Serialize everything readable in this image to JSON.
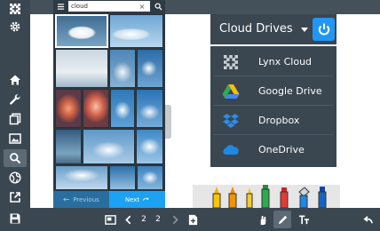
{
  "search": {
    "value": "cloud",
    "clear_glyph": "×"
  },
  "pager": {
    "prev_label": "Previous",
    "next_label": "Next"
  },
  "drives": {
    "title": "Cloud Drives",
    "items": [
      {
        "label": "Lynx Cloud",
        "icon": "lynx-cloud-icon"
      },
      {
        "label": "Google Drive",
        "icon": "google-drive-icon"
      },
      {
        "label": "Dropbox",
        "icon": "dropbox-icon"
      },
      {
        "label": "OneDrive",
        "icon": "onedrive-icon"
      }
    ]
  },
  "pagination": {
    "current": "2",
    "total": "2"
  },
  "colors": {
    "toolbar_bg": "#3a4650",
    "panel_bg": "#2e3a44",
    "accent": "#1da1f2",
    "power_button": "#2196f3"
  }
}
